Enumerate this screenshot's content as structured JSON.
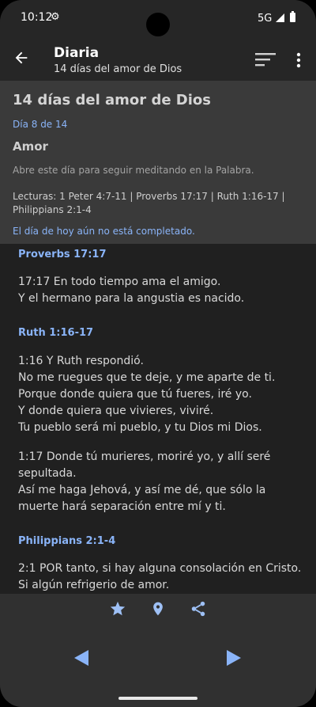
{
  "status": {
    "time": "10:12",
    "network": "5G"
  },
  "appbar": {
    "title": "Diaria",
    "subtitle": "14 días del amor de Dios"
  },
  "header": {
    "plan_title": "14 días del amor de Dios",
    "day_progress": "Día 8 de 14",
    "day_title": "Amor",
    "day_description": "Abre este día para seguir meditando en la Palabra.",
    "readings": "Lecturas: 1 Peter 4:7-11 | Proverbs 17:17 | Ruth 1:16-17 | Philippians 2:1-4",
    "status_message": "El día de hoy aún no está completado."
  },
  "passages": [
    {
      "ref": "Proverbs 17:17"
    },
    {
      "ref": "Ruth 1:16-17"
    },
    {
      "ref": "Philippians 2:1-4"
    }
  ],
  "verses": [
    "17:17 En todo tiempo ama el amigo.\nY el hermano para la angustia es nacido.",
    "1:16 Y Ruth respondió.\nNo me ruegues que te deje, y me aparte de ti.\nPorque donde quiera que tú fueres, iré yo.\nY donde quiera que vivieres, viviré.\nTu pueblo será mi pueblo, y tu Dios mi Dios.",
    "1:17 Donde tú murieres, moriré yo, y allí seré sepultada.\nAsí me haga Jehová, y así me dé, que sólo la muerte hará separación entre mí y ti.",
    "2:1 POR tanto, si hay alguna consolación en Cristo.\nSi algún refrigerio de amor."
  ],
  "icons": {
    "settings": "gear-icon",
    "back": "arrow-back-icon",
    "sort": "sort-icon",
    "more": "more-vert-icon",
    "favorite": "star-icon",
    "location": "pin-icon",
    "share": "share-icon",
    "previous": "previous-icon",
    "next": "next-icon"
  },
  "colors": {
    "accent": "#8ab4f8",
    "appbar": "#262626",
    "header_panel": "#3a3a3a",
    "background": "#202020"
  }
}
